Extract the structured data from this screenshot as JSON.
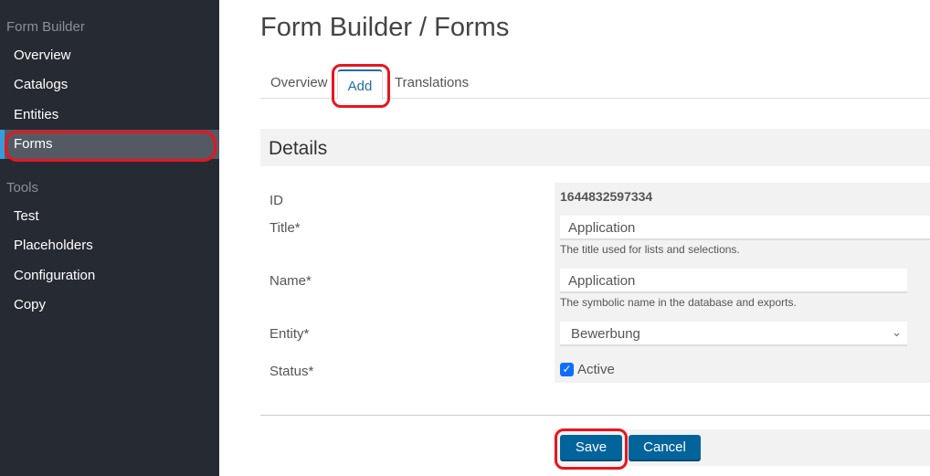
{
  "sidebar": {
    "sections": [
      {
        "title": "Form Builder",
        "items": [
          "Overview",
          "Catalogs",
          "Entities",
          "Forms"
        ]
      },
      {
        "title": "Tools",
        "items": [
          "Test",
          "Placeholders",
          "Configuration",
          "Copy"
        ]
      }
    ],
    "active_item": "Forms",
    "accent": "#3a9ad9"
  },
  "header": {
    "title": "Form Builder / Forms"
  },
  "tabs": [
    {
      "label": "Overview"
    },
    {
      "label": "Add",
      "active": true
    },
    {
      "label": "Translations"
    }
  ],
  "details": {
    "heading": "Details",
    "id_label": "ID",
    "id_value": "1644832597334",
    "title_label": "Title*",
    "title_value": "Application",
    "title_help": "The title used for lists and selections.",
    "name_label": "Name*",
    "name_value": "Application",
    "name_help": "The symbolic name in the database and exports.",
    "entity_label": "Entity*",
    "entity_value": "Bewerbung",
    "status_label": "Status*",
    "status_checkbox": "Active",
    "status_checked": true
  },
  "actions": {
    "save": "Save",
    "cancel": "Cancel",
    "button_color": "#03649c"
  },
  "annotation_color": "#e8151e"
}
